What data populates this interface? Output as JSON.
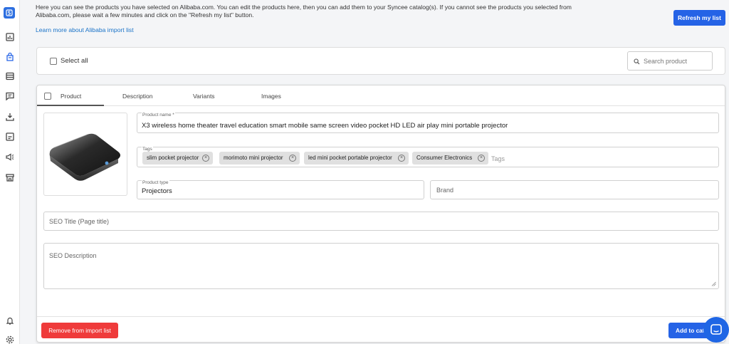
{
  "sidebar": {
    "icons": [
      "syncee-logo-icon",
      "dashboard-icon",
      "import-list-icon",
      "catalog-list-icon",
      "messages-icon",
      "download-icon",
      "reports-icon",
      "campaign-icon",
      "store-icon",
      "bell-icon",
      "settings-icon"
    ]
  },
  "header": {
    "info_text": "Here you can see the products you have selected on Alibaba.com. You can edit the products here, then you can add them to your Syncee catalog(s). If you cannot see the products you selected from Alibaba.com, please wait a few minutes and click on the \"Refresh my list\" button.",
    "learn_link": "Learn more about Alibaba import list",
    "refresh_label": "Refresh my list"
  },
  "toolbar": {
    "select_all_label": "Select all",
    "search_placeholder": "Search product"
  },
  "product": {
    "tabs": [
      {
        "label": "Product"
      },
      {
        "label": "Description"
      },
      {
        "label": "Variants"
      },
      {
        "label": "Images"
      }
    ],
    "name_label": "Product name *",
    "name_value": "X3 wireless  home theater travel education smart mobile same screen video pocket HD LED air play mini portable projector",
    "tags_label": "Tags",
    "tags": [
      {
        "label": "slim pocket projector"
      },
      {
        "label": "morimoto mini projector"
      },
      {
        "label": "led mini pocket portable projector"
      },
      {
        "label": "Consumer Electronics"
      }
    ],
    "tags_placeholder": "Tags",
    "type_label": "Product type",
    "type_value": "Projectors",
    "brand_placeholder": "Brand",
    "seo_title_placeholder": "SEO Title (Page title)",
    "seo_description_placeholder": "SEO Description",
    "remove_label": "Remove from import list",
    "add_label": "Add to cata"
  },
  "colors": {
    "primary": "#2563e6",
    "danger": "#ef3b3b",
    "link": "#1a73c8"
  }
}
